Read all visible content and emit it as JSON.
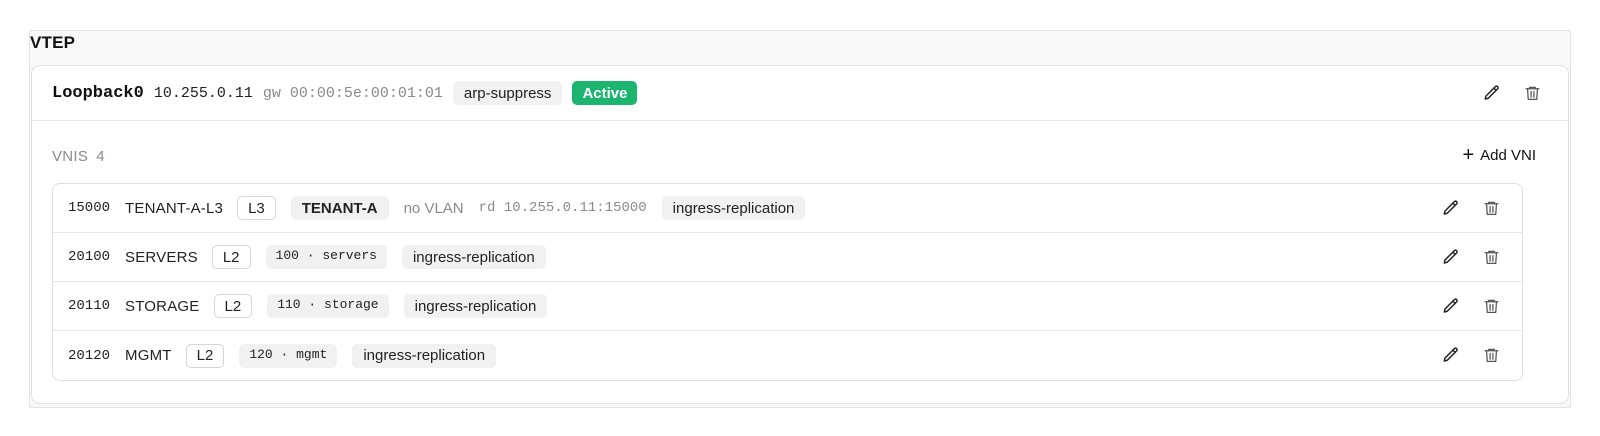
{
  "section": {
    "title": "VTEP"
  },
  "vtep": {
    "interface": "Loopback0",
    "ip": "10.255.0.11",
    "gateway": "gw 00:00:5e:00:01:01",
    "mode_tag": "arp-suppress",
    "status": "Active",
    "status_color": "#1bb56f"
  },
  "vnis": {
    "label": "VNIS",
    "count": "4",
    "add_label": "Add VNI",
    "rows": [
      {
        "id": "15000",
        "name": "TENANT-A-L3",
        "type": "L3",
        "vrf": "TENANT-A",
        "vlan": "no VLAN",
        "rd": "rd 10.255.0.11:15000",
        "replication": "ingress-replication"
      },
      {
        "id": "20100",
        "name": "SERVERS",
        "type": "L2",
        "vlan": "100 · servers",
        "replication": "ingress-replication"
      },
      {
        "id": "20110",
        "name": "STORAGE",
        "type": "L2",
        "vlan": "110 · storage",
        "replication": "ingress-replication"
      },
      {
        "id": "20120",
        "name": "MGMT",
        "type": "L2",
        "vlan": "120 · mgmt",
        "replication": "ingress-replication"
      }
    ]
  },
  "icons": {
    "edit": "pencil-icon",
    "delete": "trash-icon",
    "add": "plus-icon"
  }
}
